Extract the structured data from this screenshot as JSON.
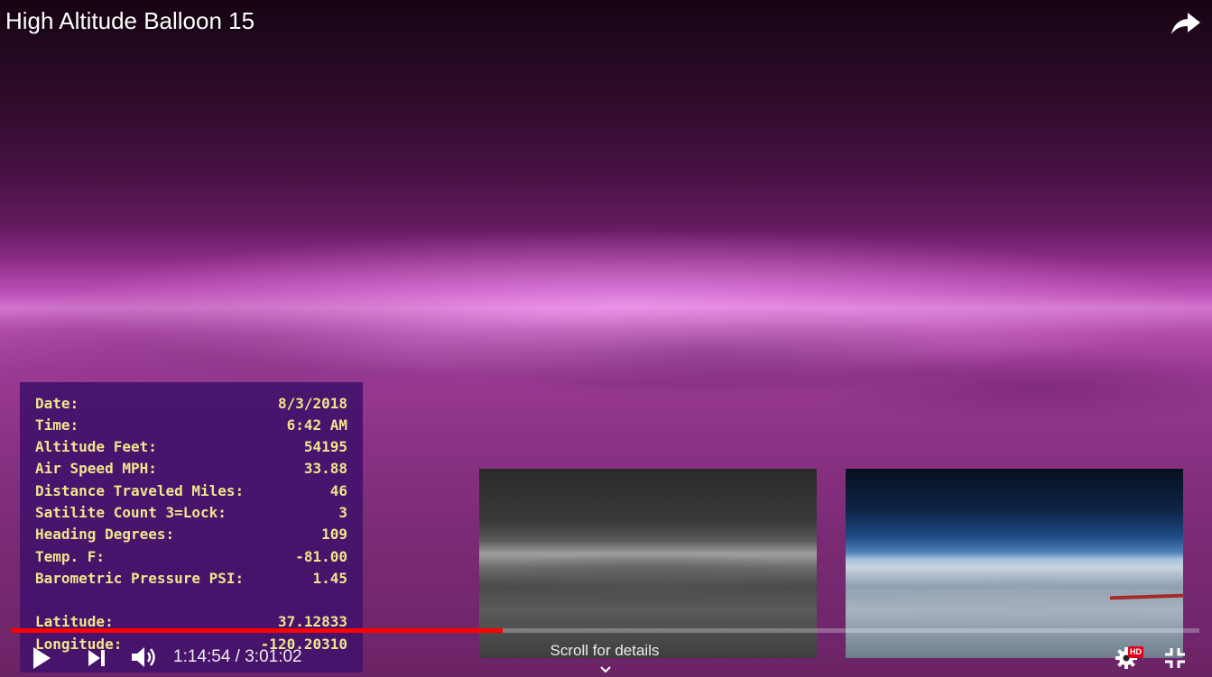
{
  "player": {
    "title": "High Altitude Balloon 15",
    "time_display": "1:14:54 / 3:01:02",
    "progress_fraction": 0.414,
    "scroll_hint": "Scroll for details",
    "hd_badge": "HD",
    "colors": {
      "progress": "#ff0000",
      "telemetry_bg": "#44126c",
      "telemetry_text": "#f0e68c"
    },
    "icons": {
      "share": "share-arrow-icon",
      "play": "play-icon",
      "next": "next-icon",
      "volume": "volume-icon",
      "settings": "gear-icon",
      "exit_fullscreen": "exit-fullscreen-icon",
      "scroll": "chevron-down-icon"
    }
  },
  "telemetry": {
    "rows": [
      {
        "label": "Date:",
        "value": "8/3/2018"
      },
      {
        "label": "Time:",
        "value": "6:42 AM"
      },
      {
        "label": "Altitude Feet:",
        "value": "54195"
      },
      {
        "label": "Air Speed MPH:",
        "value": "33.88"
      },
      {
        "label": "Distance Traveled Miles:",
        "value": "46"
      },
      {
        "label": "Satilite Count 3=Lock:",
        "value": "3"
      },
      {
        "label": "Heading Degrees:",
        "value": "109"
      },
      {
        "label": "Temp. F:",
        "value": "-81.00"
      },
      {
        "label": "Barometric Pressure PSI:",
        "value": "1.45"
      }
    ],
    "latitude": {
      "label": "Latitude:",
      "value": "37.12833"
    },
    "longitude": {
      "label": "Longitude:",
      "value": "-120.20310"
    }
  }
}
